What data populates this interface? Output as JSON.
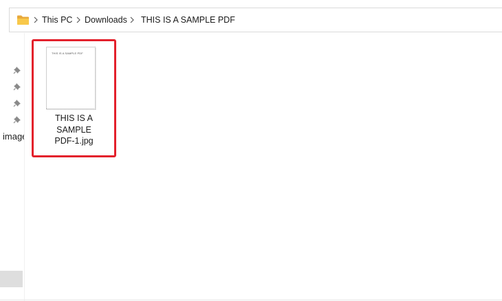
{
  "address_bar": {
    "folder_icon": "folder-icon",
    "separator_icon": "chevron-right-icon",
    "breadcrumbs": [
      "This PC",
      "Downloads",
      "THIS IS A SAMPLE PDF"
    ]
  },
  "nav_pane": {
    "pin_icon": "pin-icon",
    "partial_label": "image"
  },
  "file": {
    "name_lines": [
      "THIS IS A",
      "SAMPLE",
      "PDF-1.jpg"
    ],
    "thumbnail_text": "THIS IS A SAMPLE PDF",
    "highlight_color": "#e3202b"
  }
}
